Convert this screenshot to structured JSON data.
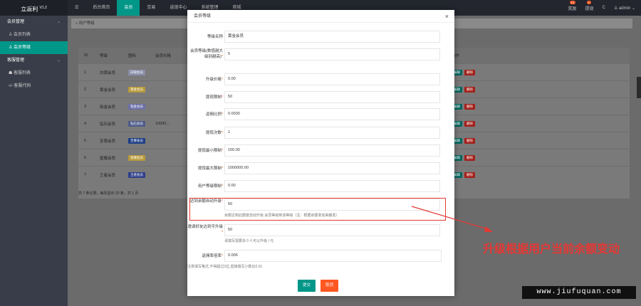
{
  "app": {
    "logo": "立返利",
    "version": "V1.2"
  },
  "topnav": [
    "☰",
    "后台首页",
    "会员",
    "交易",
    "返现中心",
    "系统管理",
    "商城"
  ],
  "topright": {
    "stats": "奖励",
    "stats_count": "12",
    "withdraw": "提现",
    "withdraw_count": "0",
    "refresh": "C",
    "user": "admin"
  },
  "sidebar": [
    {
      "type": "group",
      "label": "会员管理"
    },
    {
      "type": "item",
      "label": "会员列表",
      "icon": "user-icon",
      "active": false
    },
    {
      "type": "item",
      "label": "会员等级",
      "icon": "user-icon",
      "active": true
    },
    {
      "type": "group",
      "label": "客服管理"
    },
    {
      "type": "item",
      "label": "客服列表",
      "icon": "users-icon",
      "active": false
    },
    {
      "type": "item",
      "label": "客服代码",
      "icon": "code-icon",
      "active": false
    }
  ],
  "breadcrumb": "用户等级",
  "table": {
    "headers": [
      "ID",
      "等级",
      "图标",
      "会员价格",
      "操作"
    ],
    "rows": [
      {
        "id": "1",
        "name": "白银会员",
        "tag_color": "#8a8fa8",
        "price": ""
      },
      {
        "id": "2",
        "name": "黄金会员",
        "tag_color": "#b89a3a",
        "price": ""
      },
      {
        "id": "3",
        "name": "铂金会员",
        "tag_color": "#6d6fa8",
        "price": ""
      },
      {
        "id": "4",
        "name": "钻石会员",
        "tag_color": "#4f5a8a",
        "price": "10000..."
      },
      {
        "id": "5",
        "name": "至尊会员",
        "tag_color": "#1e3f85",
        "price": ""
      },
      {
        "id": "6",
        "name": "星耀会员",
        "tag_color": "#b89a3a",
        "price": ""
      },
      {
        "id": "7",
        "name": "王者会员",
        "tag_color": "#2e3f8a",
        "price": ""
      }
    ],
    "edit_label": "编辑",
    "delete_label": "删除",
    "pager": "共 7 条记录，每页显示 20 条，共 1 页",
    "per_page": "20"
  },
  "modal": {
    "title": "会员等级",
    "fields": [
      {
        "label": "等级名称",
        "required": false,
        "value": "黄金会员",
        "hint": ""
      },
      {
        "label": "会员等级(数值越大级别越高)",
        "required": true,
        "value": "5",
        "hint": ""
      },
      {
        "label": "升级价格",
        "required": true,
        "value": "0.00",
        "hint": ""
      },
      {
        "label": "提现限制",
        "required": true,
        "value": "50",
        "hint": ""
      },
      {
        "label": "返佣比例",
        "required": true,
        "value": "0.0030",
        "hint": ""
      },
      {
        "label": "提现次数",
        "required": true,
        "value": "1",
        "hint": ""
      },
      {
        "label": "提现最小限制",
        "required": true,
        "value": "100.00",
        "hint": ""
      },
      {
        "label": "提现最大限制",
        "required": true,
        "value": "1000000.00",
        "hint": ""
      },
      {
        "label": "用户等级限制",
        "required": true,
        "value": "0.00",
        "hint": ""
      },
      {
        "label": "达到余额自动升级",
        "required": true,
        "value": "50",
        "hint": "余额达到此额度自动升级 会员等级到该等级（注：根据余额变动来触发）"
      },
      {
        "label": "邀请好友达到可升级",
        "required": true,
        "value": "50",
        "hint": "请填写需要多少人可以升级 / 元"
      },
      {
        "label": "返佣率倍率",
        "required": true,
        "value": "0.006",
        "hint": "注意填写格式,不得超过2位,直接填写小数比0.01"
      }
    ],
    "submit": "提交",
    "cancel": "取消"
  },
  "annotation": "升级根据用户当前余额变动",
  "watermark": "www.jiufuquan.com"
}
